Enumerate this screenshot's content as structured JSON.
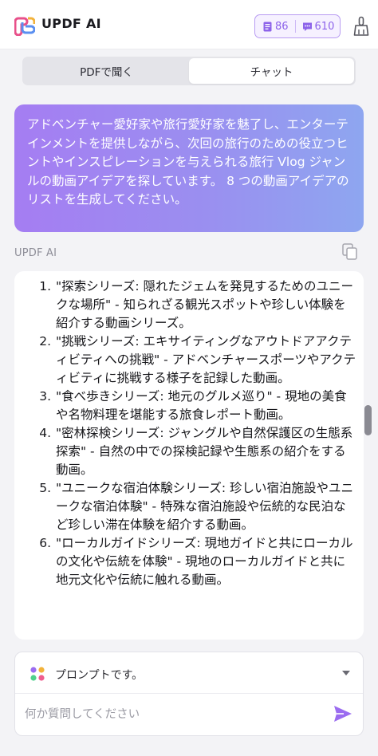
{
  "app": {
    "title": "UPDF AI"
  },
  "credits": {
    "pages": "86",
    "messages": "610"
  },
  "tabs": [
    {
      "label": "PDFで聞く",
      "active": false
    },
    {
      "label": "チャット",
      "active": true
    }
  ],
  "user_prompt": "アドベンチャー愛好家や旅行愛好家を魅了し、エンターテインメントを提供しながら、次回の旅行のための役立つヒントやインスピレーションを与えられる旅行 Vlog ジャンルの動画アイデアを探しています。 8 つの動画アイデアのリストを生成してください。",
  "assistant": {
    "label": "UPDF AI",
    "items": [
      {
        "num": "1.",
        "text": "\"探索シリーズ: 隠れたジェムを発見するためのユニークな場所\" - 知られざる観光スポットや珍しい体験を紹介する動画シリーズ。"
      },
      {
        "num": "2.",
        "text": "\"挑戦シリーズ: エキサイティングなアウトドアアクティビティへの挑戦\" - アドベンチャースポーツやアクティビティに挑戦する様子を記録した動画。"
      },
      {
        "num": "3.",
        "text": "\"食べ歩きシリーズ: 地元のグルメ巡り\" - 現地の美食や名物料理を堪能する旅食レポート動画。"
      },
      {
        "num": "4.",
        "text": "\"密林探検シリーズ: ジャングルや自然保護区の生態系探索\" - 自然の中での探検記録や生態系の紹介をする動画。"
      },
      {
        "num": "5.",
        "text": "\"ユニークな宿泊体験シリーズ: 珍しい宿泊施設やユニークな宿泊体験\" - 特殊な宿泊施設や伝統的な民泊など珍しい滞在体験を紹介する動画。"
      },
      {
        "num": "6.",
        "text": "\"ローカルガイドシリーズ: 現地ガイドと共にローカルの文化や伝統を体験\" - 現地のローカルガイドと共に地元文化や伝統に触れる動画。"
      }
    ]
  },
  "composer": {
    "prompt_label": "プロンプトです。",
    "placeholder": "何か質問してください"
  },
  "colors": {
    "accent": "#8d63ea",
    "bubble_start": "#a57df2",
    "bubble_end": "#8ea6f0"
  },
  "icons": {
    "logo": "updf-logo-icon",
    "pages": "document-icon",
    "messages": "chat-icon",
    "clean": "broom-icon",
    "copy": "copy-icon",
    "prompt": "prompt-dots-icon",
    "caret": "chevron-down-icon",
    "send": "send-icon"
  }
}
